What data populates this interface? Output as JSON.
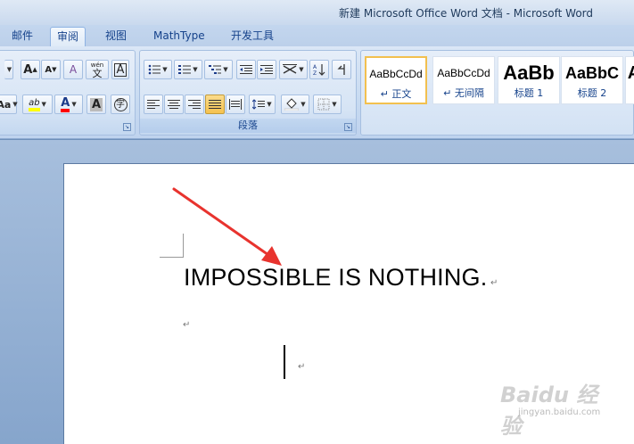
{
  "window": {
    "title": "新建 Microsoft Office Word 文档 - Microsoft Word"
  },
  "tabs": [
    {
      "label": "邮件",
      "active": false
    },
    {
      "label": "审阅",
      "active": true
    },
    {
      "label": "视图",
      "active": false
    },
    {
      "label": "MathType",
      "active": false
    },
    {
      "label": "开发工具",
      "active": false
    }
  ],
  "ribbon": {
    "paragraph_group_label": "段落",
    "font_buttons": {
      "case_label": "Aa",
      "grow_font": "A",
      "shrink_font": "A",
      "clear_format": "A",
      "phonetic": "wén",
      "phonetic_char": "文",
      "char_border": "A",
      "highlight": "ab",
      "font_color": "A",
      "char_shading": "A",
      "enclose": "字"
    },
    "styles": [
      {
        "sample": "AaBbCcDd",
        "name": "↵ 正文",
        "selected": true
      },
      {
        "sample": "AaBbCcDd",
        "name": "↵ 无间隔",
        "selected": false
      },
      {
        "sample": "AaBb",
        "name": "标题 1",
        "selected": false
      },
      {
        "sample": "AaBbC",
        "name": "标题 2",
        "selected": false
      }
    ]
  },
  "document": {
    "text": "IMPOSSIBLE IS NOTHING.",
    "paragraph_mark": "↵"
  },
  "watermark": {
    "brand": "Baidu 经验",
    "url": "jingyan.baidu.com"
  },
  "colors": {
    "highlight": "#ffff00",
    "font_color": "#ff0000",
    "arrow": "#e8332e"
  }
}
